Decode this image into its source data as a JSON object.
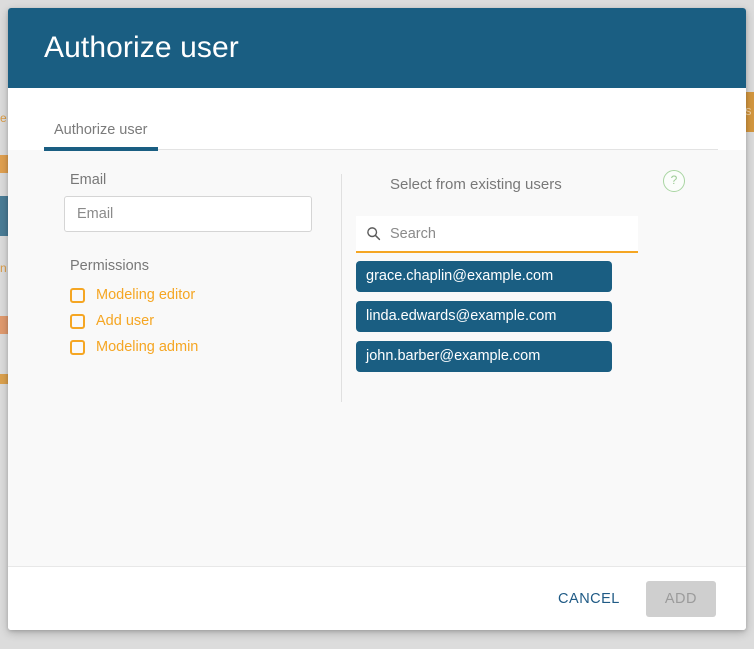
{
  "dialog": {
    "title": "Authorize user",
    "tabs": [
      {
        "label": "Authorize user",
        "active": true
      }
    ]
  },
  "left_panel": {
    "email": {
      "label": "Email",
      "placeholder": "Email",
      "value": ""
    },
    "permissions": {
      "label": "Permissions",
      "options": [
        {
          "label": "Modeling editor",
          "checked": false
        },
        {
          "label": "Add user",
          "checked": false
        },
        {
          "label": "Modeling admin",
          "checked": false
        }
      ]
    }
  },
  "right_panel": {
    "heading": "Select from existing users",
    "help_icon_glyph": "?",
    "search": {
      "placeholder": "Search",
      "value": ""
    },
    "users": [
      "grace.chaplin@example.com",
      "linda.edwards@example.com",
      "john.barber@example.com"
    ]
  },
  "footer": {
    "cancel_label": "CANCEL",
    "add_label": "ADD",
    "add_disabled": true
  },
  "background_bleed": {
    "left_glyph_a": "e",
    "left_glyph_d": "n",
    "right_glyph": "s"
  },
  "colors": {
    "header_blue": "#1a5e82",
    "accent_orange": "#f5a623",
    "chip_blue": "#1a5e82",
    "body_gray": "#f9f9f9",
    "help_green": "#9ccb95",
    "disabled_gray": "#cfcfcf"
  }
}
